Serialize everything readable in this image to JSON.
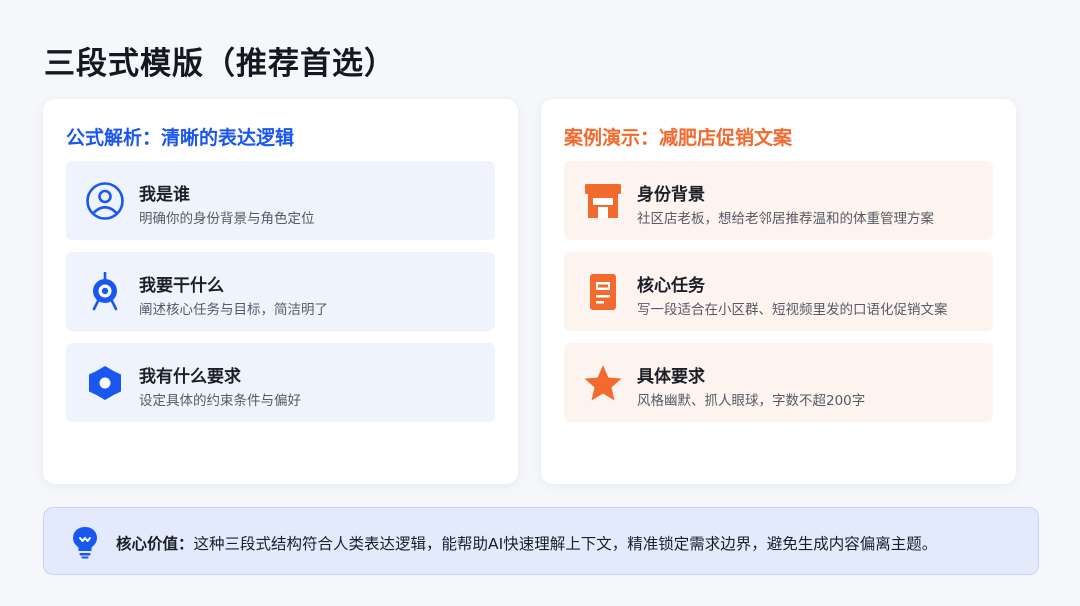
{
  "page": {
    "title": "三段式模版（推荐首选）"
  },
  "left_card": {
    "heading": "公式解析：清晰的表达逻辑",
    "accent_color": "#1a56f0",
    "items": [
      {
        "title": "我是谁",
        "desc": "明确你的身份背景与角色定位",
        "icon": "user-circle-icon"
      },
      {
        "title": "我要干什么",
        "desc": "阐述核心任务与目标，简洁明了",
        "icon": "target-icon"
      },
      {
        "title": "我有什么要求",
        "desc": "设定具体的约束条件与偏好",
        "icon": "gear-icon"
      }
    ]
  },
  "right_card": {
    "heading": "案例演示：减肥店促销文案",
    "accent_color": "#f26a2e",
    "items": [
      {
        "title": "身份背景",
        "desc": "社区店老板，想给老邻居推荐温和的体重管理方案",
        "icon": "store-icon"
      },
      {
        "title": "核心任务",
        "desc": "写一段适合在小区群、短视频里发的口语化促销文案",
        "icon": "document-icon"
      },
      {
        "title": "具体要求",
        "desc": "风格幽默、抓人眼球，字数不超200字",
        "icon": "star-icon"
      }
    ]
  },
  "footer": {
    "label": "核心价值：",
    "text": "这种三段式结构符合人类表达逻辑，能帮助AI快速理解上下文，精准锁定需求边界，避免生成内容偏离主题。",
    "icon": "lightbulb-icon"
  }
}
